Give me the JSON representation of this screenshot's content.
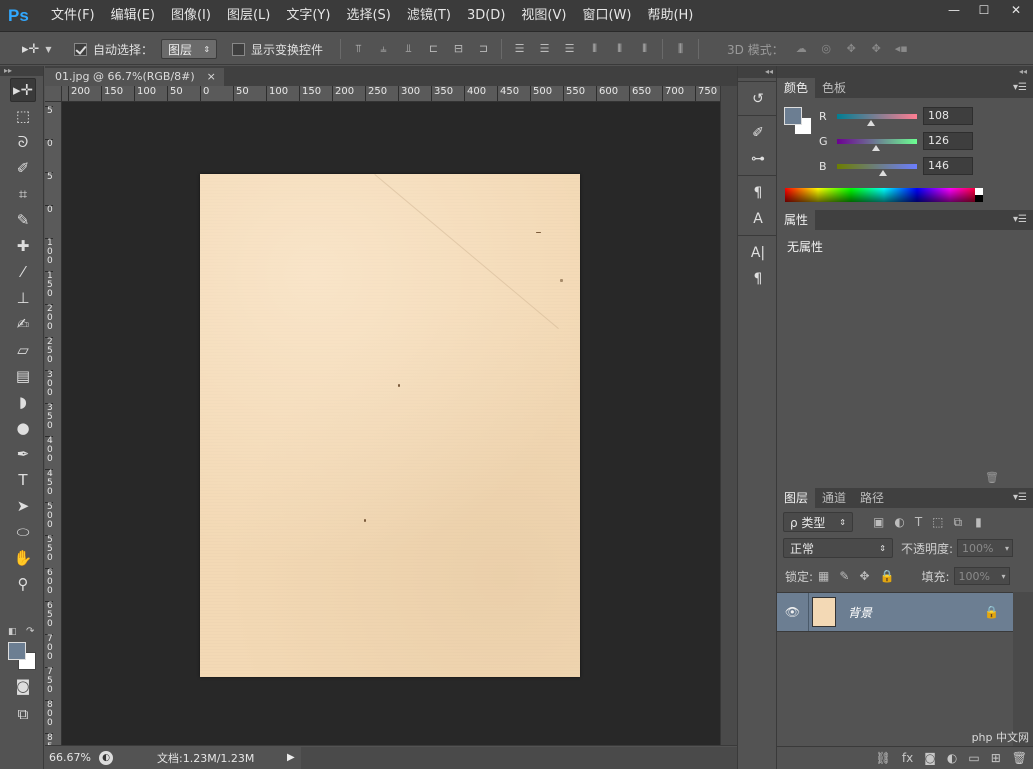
{
  "app": {
    "logo": "Ps",
    "menu": [
      "文件(F)",
      "编辑(E)",
      "图像(I)",
      "图层(L)",
      "文字(Y)",
      "选择(S)",
      "滤镜(T)",
      "3D(D)",
      "视图(V)",
      "窗口(W)",
      "帮助(H)"
    ],
    "window_controls": [
      "—",
      "☐",
      "✕"
    ]
  },
  "options": {
    "auto_select_label": "自动选择：",
    "auto_select_checked": true,
    "auto_select_target": "图层",
    "show_transform_label": "显示变换控件",
    "show_transform_checked": false,
    "mode_3d_label": "3D 模式："
  },
  "document": {
    "tab_title": "01.jpg @ 66.7%(RGB/8#)",
    "tab_close": "×",
    "ruler_h_labels": [
      "200",
      "150",
      "100",
      "50",
      "0",
      "50",
      "100",
      "150",
      "200",
      "250",
      "300",
      "350",
      "400",
      "450",
      "500",
      "550",
      "600",
      "650",
      "700",
      "750"
    ],
    "ruler_v_labels": [
      "5",
      "0",
      "5",
      "0",
      "1 0 0",
      "1 5 0",
      "2 0 0",
      "2 5 0",
      "3 0 0",
      "3 5 0",
      "4 0 0",
      "4 5 0",
      "5 0 0",
      "5 5 0",
      "6 0 0",
      "6 5 0",
      "7 0 0",
      "7 5 0",
      "8 0 0",
      "8 5 0"
    ],
    "paper_color": "#f3d9b5"
  },
  "status": {
    "zoom": "66.67%",
    "doc_info": "文档:1.23M/1.23M",
    "arrow": "▶"
  },
  "tools": [
    {
      "name": "move-tool",
      "glyph": "▸✛",
      "active": true
    },
    {
      "name": "marquee-tool",
      "glyph": "⬚"
    },
    {
      "name": "lasso-tool",
      "glyph": "ᘐ"
    },
    {
      "name": "quick-select-tool",
      "glyph": "✐"
    },
    {
      "name": "crop-tool",
      "glyph": "⌗"
    },
    {
      "name": "eyedropper-tool",
      "glyph": "✎"
    },
    {
      "name": "healing-brush-tool",
      "glyph": "✚"
    },
    {
      "name": "brush-tool",
      "glyph": "⁄"
    },
    {
      "name": "clone-stamp-tool",
      "glyph": "⊥"
    },
    {
      "name": "history-brush-tool",
      "glyph": "✍"
    },
    {
      "name": "eraser-tool",
      "glyph": "▱"
    },
    {
      "name": "gradient-tool",
      "glyph": "▤"
    },
    {
      "name": "blur-tool",
      "glyph": "◗"
    },
    {
      "name": "dodge-tool",
      "glyph": "●"
    },
    {
      "name": "pen-tool",
      "glyph": "✒"
    },
    {
      "name": "type-tool",
      "glyph": "T"
    },
    {
      "name": "path-select-tool",
      "glyph": "➤"
    },
    {
      "name": "shape-tool",
      "glyph": "⬭"
    },
    {
      "name": "hand-tool",
      "glyph": "✋"
    },
    {
      "name": "zoom-tool",
      "glyph": "⚲"
    }
  ],
  "colors": {
    "foreground": "#6c7e92",
    "background": "#ffffff",
    "accent_layer": "#6c7e92"
  },
  "color_panel": {
    "tabs": [
      "颜色",
      "色板"
    ],
    "r_label": "R",
    "r_value": "108",
    "g_label": "G",
    "g_value": "126",
    "b_label": "B",
    "b_value": "146",
    "r_fraction": 0.42,
    "g_fraction": 0.49,
    "b_fraction": 0.57
  },
  "properties_panel": {
    "tabs": [
      "属性"
    ],
    "text": "无属性"
  },
  "layers_panel": {
    "tabs": [
      "图层",
      "通道",
      "路径"
    ],
    "filter_label": "ρ 类型",
    "blend_mode": "正常",
    "opacity_label": "不透明度:",
    "opacity_value": "100%",
    "lock_label": "锁定:",
    "fill_label": "填充:",
    "fill_value": "100%",
    "layer_name": "背景"
  },
  "watermark": "php 中文网"
}
